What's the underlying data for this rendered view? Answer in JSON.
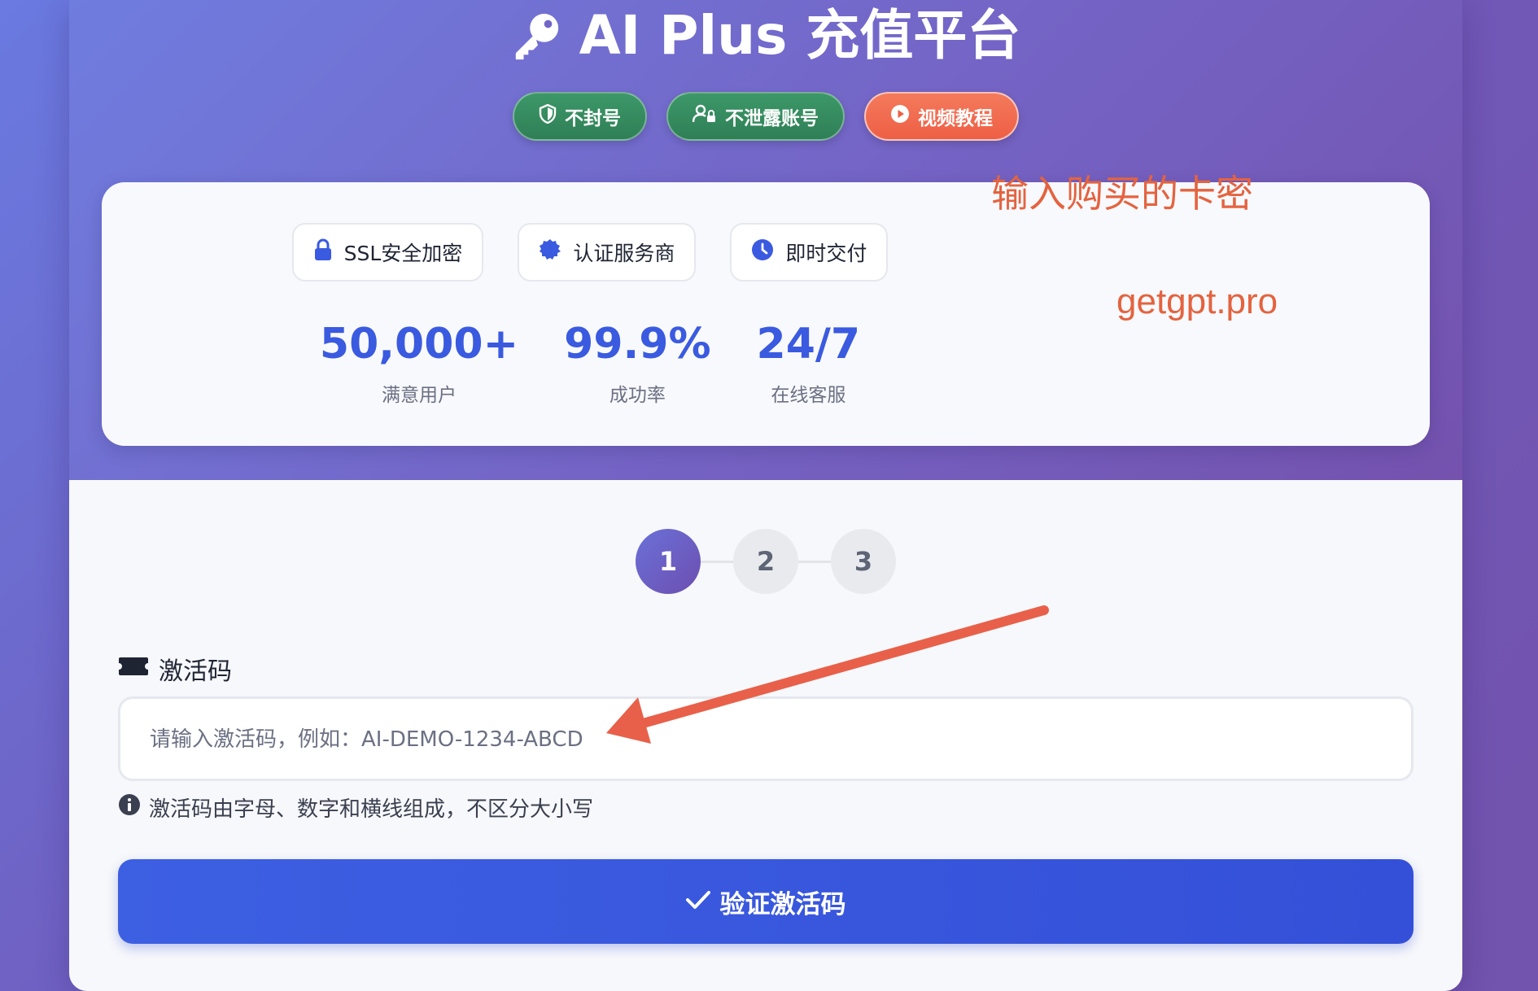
{
  "header": {
    "title": "AI Plus 充值平台",
    "badges": [
      {
        "label": "不封号",
        "icon": "shield-icon"
      },
      {
        "label": "不泄露账号",
        "icon": "user-lock-icon"
      },
      {
        "label": "视频教程",
        "icon": "play-circle-icon"
      }
    ]
  },
  "trust": {
    "items": [
      {
        "label": "SSL安全加密",
        "icon": "lock-icon"
      },
      {
        "label": "认证服务商",
        "icon": "certificate-icon"
      },
      {
        "label": "即时交付",
        "icon": "clock-icon"
      }
    ],
    "stats": [
      {
        "value": "50,000+",
        "label": "满意用户"
      },
      {
        "value": "99.9%",
        "label": "成功率"
      },
      {
        "value": "24/7",
        "label": "在线客服"
      }
    ],
    "watermark": "getgpt.pro"
  },
  "steps": [
    "1",
    "2",
    "3"
  ],
  "form": {
    "label": "激活码",
    "placeholder": "请输入激活码，例如：AI-DEMO-1234-ABCD",
    "value": "",
    "hint": "激活码由字母、数字和横线组成，不区分大小写",
    "submit_label": "验证激活码"
  },
  "annotation": {
    "text": "输入购买的卡密"
  },
  "colors": {
    "accent": "#3a5ae0",
    "badge_green": "#2f7f56",
    "badge_orange": "#ee5f45",
    "annotation": "#e4633f"
  }
}
